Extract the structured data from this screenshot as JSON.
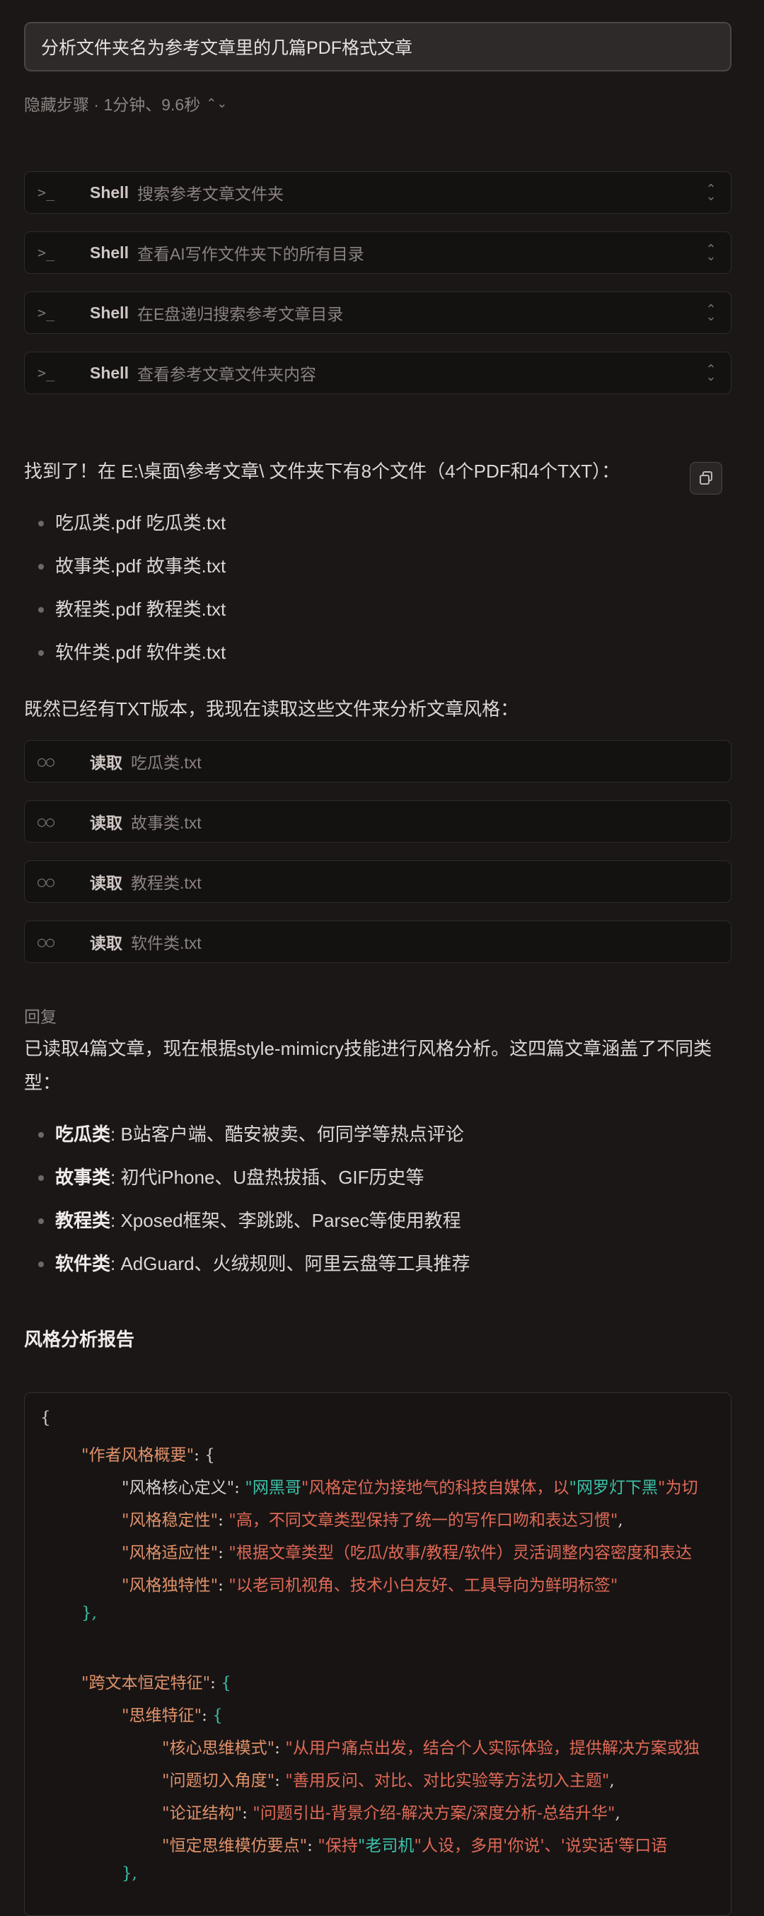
{
  "prompt": "分析文件夹名为参考文章里的几篇PDF格式文章",
  "steps_toggle": "隐藏步骤 · 1分钟、9.6秒",
  "shell_steps": [
    {
      "name": "Shell",
      "desc": "搜索参考文章文件夹",
      "icon": "terminal-icon"
    },
    {
      "name": "Shell",
      "desc": "查看AI写作文件夹下的所有目录",
      "icon": "terminal-icon"
    },
    {
      "name": "Shell",
      "desc": "在E盘递归搜索参考文章目录",
      "icon": "terminal-icon"
    },
    {
      "name": "Shell",
      "desc": "查看参考文章文件夹内容",
      "icon": "terminal-icon"
    }
  ],
  "found_text": "找到了！在 E:\\桌面\\参考文章\\ 文件夹下有8个文件（4个PDF和4个TXT）：",
  "files": [
    "吃瓜类.pdf 吃瓜类.txt",
    "故事类.pdf 故事类.txt",
    "教程类.pdf 教程类.txt",
    "软件类.pdf 软件类.txt"
  ],
  "read_intro": "既然已经有TXT版本，我现在读取这些文件来分析文章风格：",
  "read_steps": [
    {
      "name": "读取",
      "desc": "吃瓜类.txt",
      "icon": "glasses-icon"
    },
    {
      "name": "读取",
      "desc": "故事类.txt",
      "icon": "glasses-icon"
    },
    {
      "name": "读取",
      "desc": "教程类.txt",
      "icon": "glasses-icon"
    },
    {
      "name": "读取",
      "desc": "软件类.txt",
      "icon": "glasses-icon"
    }
  ],
  "reply_label": "回复",
  "reply_line1": "已读取4篇文章，现在根据style-mimicry技能进行风格分析。这四篇文章涵盖了不同类",
  "reply_line2": "型：",
  "categories": [
    {
      "label": "吃瓜类",
      "desc": ": B站客户端、酷安被卖、何同学等热点评论"
    },
    {
      "label": "故事类",
      "desc": ": 初代iPhone、U盘热拔插、GIF历史等"
    },
    {
      "label": "教程类",
      "desc": ": Xposed框架、李跳跳、Parsec等使用教程"
    },
    {
      "label": "软件类",
      "desc": ": AdGuard、火绒规则、阿里云盘等工具推荐"
    }
  ],
  "report_heading": "风格分析报告",
  "code": {
    "l1": "{",
    "l2_key": "\"作者风格概要\"",
    "l2_rest": ": {",
    "l3_key": "\"风格核心定义\"",
    "l3_sep": ": ",
    "l3_s1": "\"网黑哥",
    "l3_s2": "\"风格定位为接地气的科技自媒体，以",
    "l3_s3": "\"网罗灯下黑",
    "l3_s4": "\"为切",
    "l4_key": "\"风格稳定性\"",
    "l4_sep": ": ",
    "l4_val": "\"高，不同文章类型保持了统一的写作口吻和表达习惯\"",
    "l4_end": ",",
    "l5_key": "\"风格适应性\"",
    "l5_sep": ": ",
    "l5_val": "\"根据文章类型（吃瓜/故事/教程/软件）灵活调整内容密度和表达",
    "l6_key": "\"风格独特性\"",
    "l6_sep": ": ",
    "l6_val": "\"以老司机视角、技术小白友好、工具导向为鲜明标签\"",
    "l7": "},",
    "l9_key": "\"跨文本恒定特征\"",
    "l9_sep": ": ",
    "l9_brace": "{",
    "l10_key": "\"思维特征\"",
    "l10_sep": ": ",
    "l10_brace": "{",
    "l11_key": "\"核心思维模式\"",
    "l11_sep": ": ",
    "l11_val": "\"从用户痛点出发，结合个人实际体验，提供解决方案或独",
    "l12_key": "\"问题切入角度\"",
    "l12_sep": ": ",
    "l12_val": "\"善用反问、对比、对比实验等方法切入主题\"",
    "l12_end": ",",
    "l13_key": "\"论证结构\"",
    "l13_sep": ": ",
    "l13_val": "\"问题引出-背景介绍-解决方案/深度分析-总结升华\"",
    "l13_end": ",",
    "l14_key": "\"恒定思维模仿要点\"",
    "l14_sep": ": ",
    "l14_s1": "\"保持",
    "l14_s2": "\"老司机",
    "l14_s3": "\"人设，多用'你说'、'说实话'等口语",
    "l15": "},"
  },
  "colors": {
    "background": "#1b1717",
    "key": "#e0926a",
    "string": "#e06a56",
    "brace": "#3cc2a8"
  }
}
